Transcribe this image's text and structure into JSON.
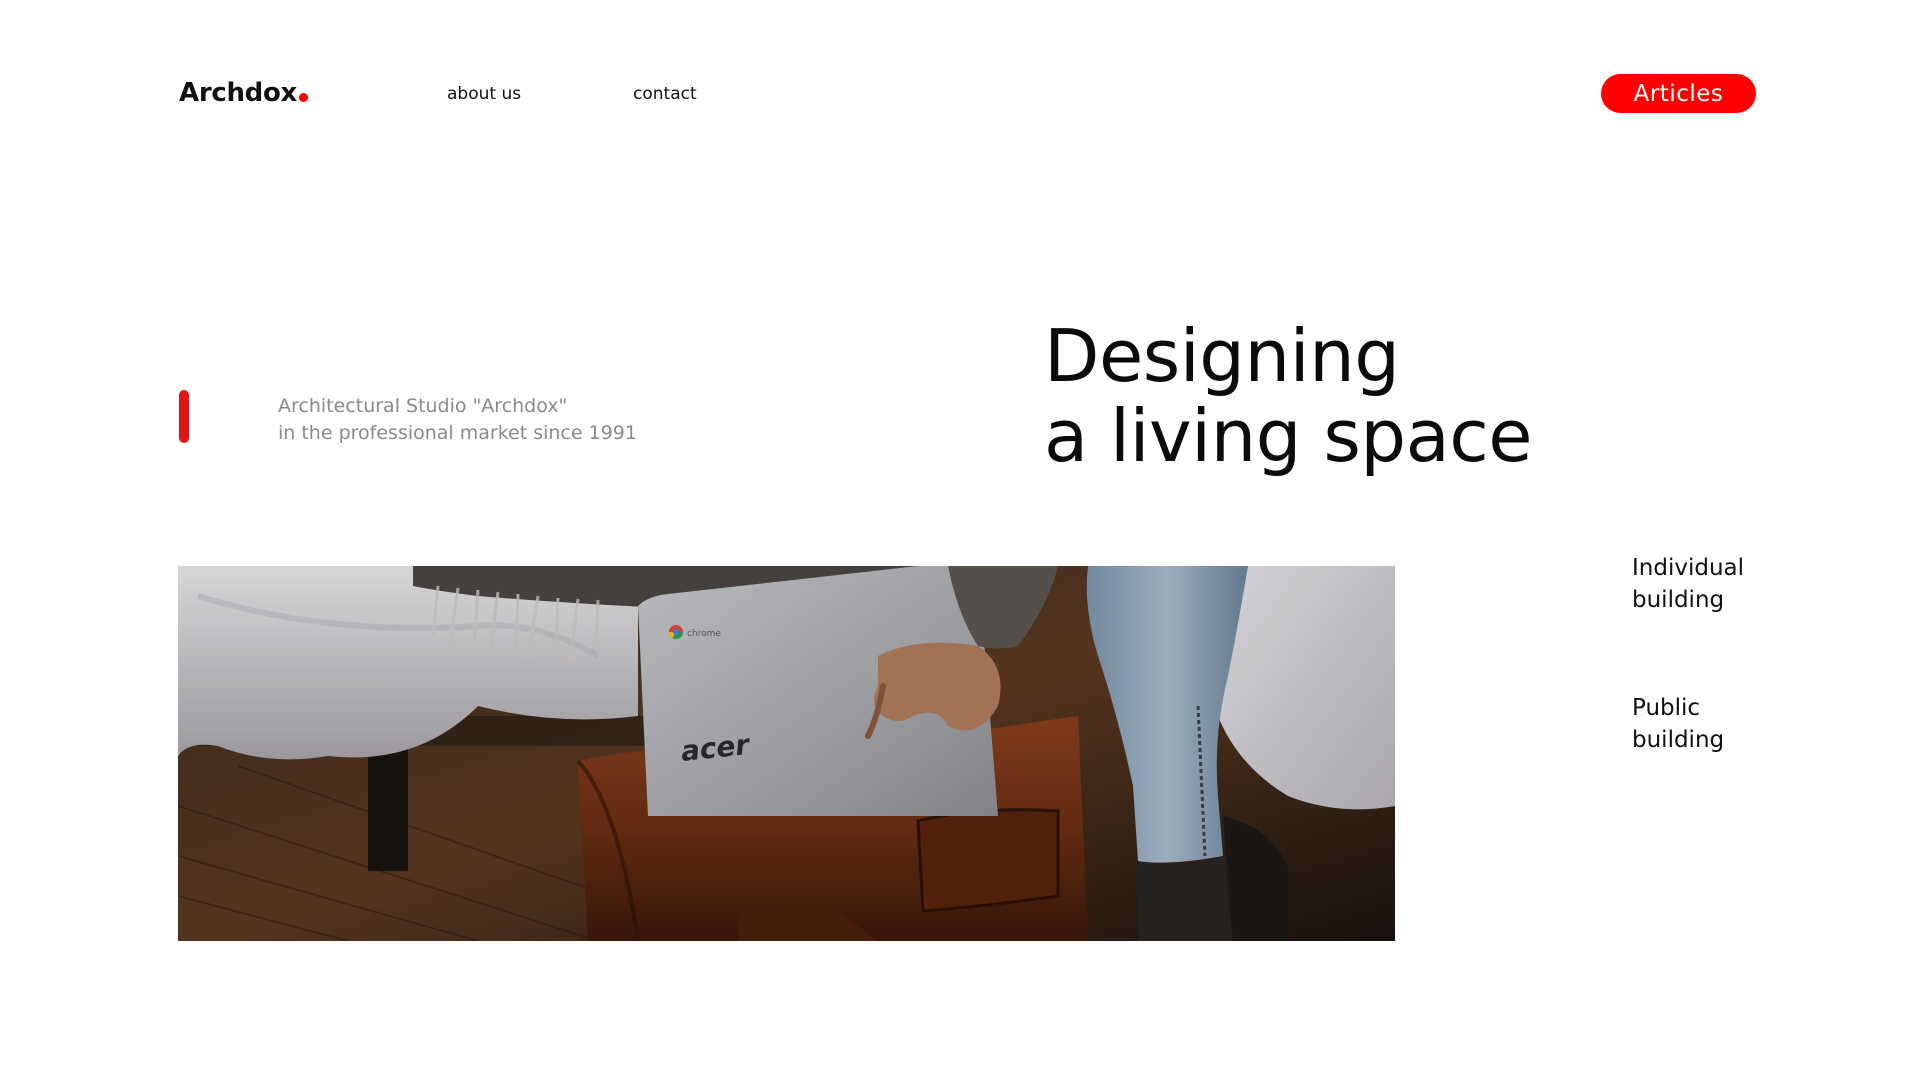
{
  "header": {
    "logo": "Archdox",
    "nav": {
      "about": "about us",
      "contact": "contact"
    },
    "articles_button": "Articles"
  },
  "intro": {
    "studio_line1": "Architectural Studio \"Archdox\"",
    "studio_line2": "in the professional market since 1991"
  },
  "hero": {
    "title_line1": "Designing",
    "title_line2": "a living space",
    "photo": {
      "laptop_brand": "acer",
      "laptop_badge": "chrome"
    }
  },
  "categories": {
    "individual_line1": "Individual",
    "individual_line2": "building",
    "public_line1": "Public",
    "public_line2": "building"
  },
  "colors": {
    "accent": "#ff0000",
    "text": "#111111",
    "muted": "#8a8a8a"
  }
}
